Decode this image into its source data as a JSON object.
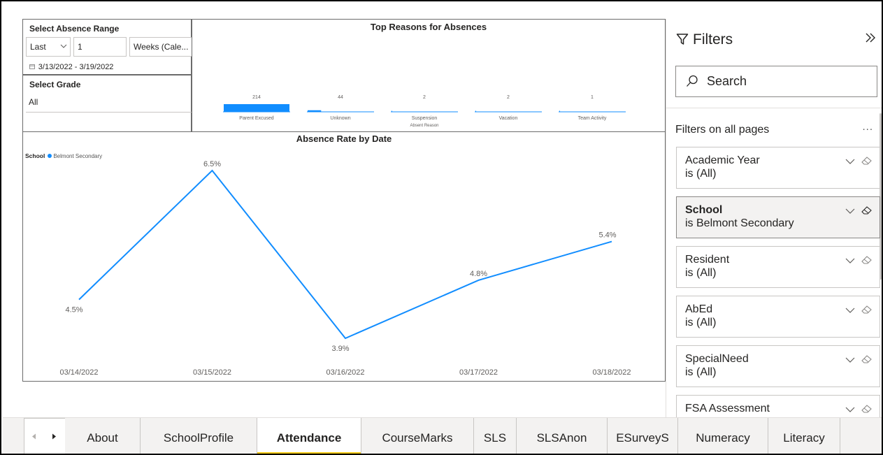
{
  "range_slicer": {
    "title": "Select Absence Range",
    "mode": "Last",
    "count": "1",
    "unit": "Weeks (Cale...",
    "dates": "3/13/2022 - 3/19/2022"
  },
  "grade_slicer": {
    "title": "Select Grade",
    "value": "All"
  },
  "bar_chart": {
    "title": "Top Reasons for Absences"
  },
  "line_chart": {
    "title": "Absence Rate by Date",
    "legend_title": "School",
    "legend_series": "Belmont Secondary"
  },
  "chart_data": [
    {
      "type": "bar",
      "title": "Top Reasons for Absences",
      "xlabel": "Absent Reason",
      "categories": [
        "Parent Excused",
        "Unknown",
        "Suspension",
        "Vacation",
        "Team Activity"
      ],
      "values": [
        214,
        44,
        2,
        2,
        1
      ],
      "color": "#118dff"
    },
    {
      "type": "line",
      "title": "Absence Rate by Date",
      "legend_title": "School",
      "series": [
        {
          "name": "Belmont Secondary",
          "color": "#118dff",
          "x": [
            "03/14/2022",
            "03/15/2022",
            "03/16/2022",
            "03/17/2022",
            "03/18/2022"
          ],
          "values": [
            4.5,
            6.5,
            3.9,
            4.8,
            5.4
          ],
          "labels": [
            "4.5%",
            "6.5%",
            "3.9%",
            "4.8%",
            "5.4%"
          ]
        }
      ],
      "ylim": [
        3.9,
        6.5
      ],
      "grid": false
    }
  ],
  "filters": {
    "title": "Filters",
    "search_placeholder": "Search",
    "section_label": "Filters on all pages",
    "more": "...",
    "cards": [
      {
        "name": "Academic Year",
        "value": "is (All)",
        "active": false
      },
      {
        "name": "School",
        "value": "is Belmont Secondary",
        "active": true
      },
      {
        "name": "Resident",
        "value": "is (All)",
        "active": false
      },
      {
        "name": "AbEd",
        "value": "is (All)",
        "active": false
      },
      {
        "name": "SpecialNeed",
        "value": "is (All)",
        "active": false
      },
      {
        "name": "FSA Assessment",
        "value": "",
        "active": false
      }
    ]
  },
  "tabs": [
    {
      "label": "About",
      "active": false
    },
    {
      "label": "SchoolProfile",
      "active": false
    },
    {
      "label": "Attendance",
      "active": true
    },
    {
      "label": "CourseMarks",
      "active": false
    },
    {
      "label": "SLS",
      "active": false
    },
    {
      "label": "SLSAnon",
      "active": false
    },
    {
      "label": "ESurveyS",
      "active": false
    },
    {
      "label": "Numeracy",
      "active": false
    },
    {
      "label": "Literacy",
      "active": false
    }
  ],
  "colors": {
    "accent": "#118dff",
    "active_tab": "#f2c811"
  }
}
